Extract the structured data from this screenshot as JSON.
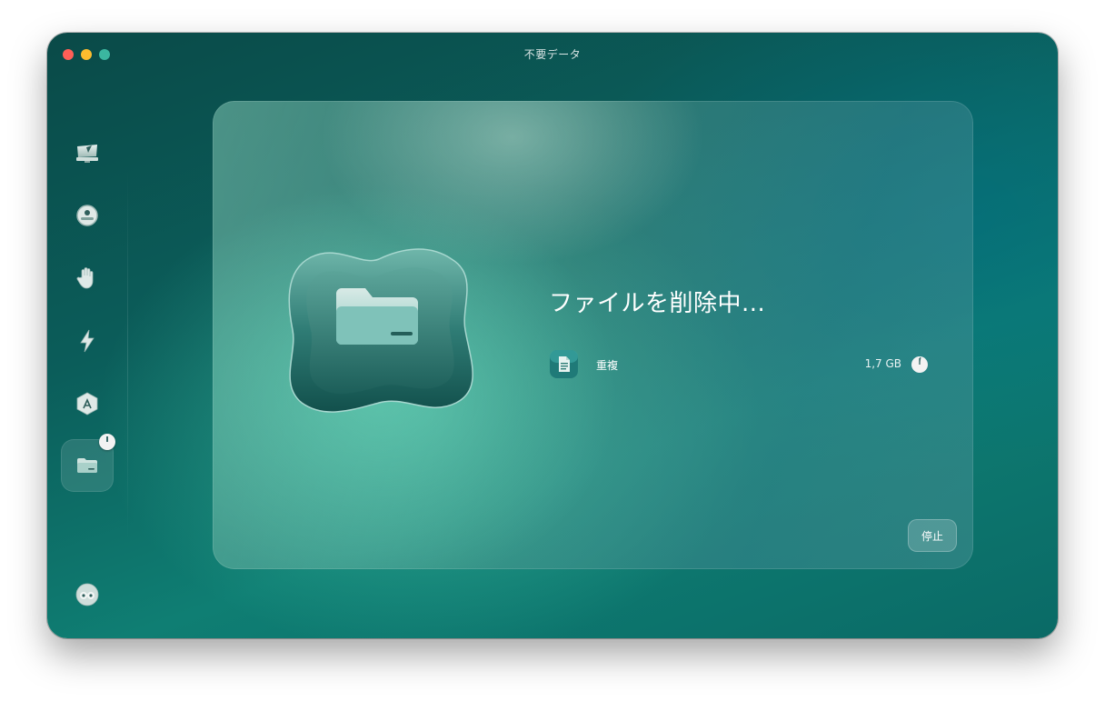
{
  "window": {
    "title": "不要データ"
  },
  "sidebar": {
    "items": [
      {
        "name": "smart-scan",
        "icon": "monitor-icon",
        "active": false
      },
      {
        "name": "protection",
        "icon": "shield-disc-icon",
        "active": false
      },
      {
        "name": "privacy",
        "icon": "hand-icon",
        "active": false
      },
      {
        "name": "performance",
        "icon": "lightning-icon",
        "active": false
      },
      {
        "name": "applications",
        "icon": "app-store-icon",
        "active": false
      },
      {
        "name": "clutter",
        "icon": "folder-icon",
        "active": true,
        "badge": "progress-indicator"
      },
      {
        "name": "assistant",
        "icon": "assistant-icon",
        "active": false
      }
    ]
  },
  "main": {
    "heading": "ファイルを削除中...",
    "task": {
      "name": "重複",
      "size": "1,7 GB",
      "icon": "document-icon"
    },
    "stop_label": "停止"
  },
  "colors": {
    "accent": "#0f7e73",
    "window_bg": "#0b5d5a",
    "traffic_close": "#ff5f57",
    "traffic_minimize": "#febc2e",
    "traffic_zoom": "#3bb6a0"
  }
}
